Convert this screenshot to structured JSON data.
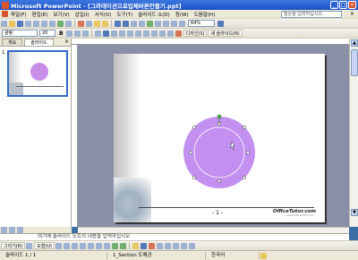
{
  "window": {
    "title": "Microsoft PowerPoint - [그라데이션으로입체바른만들기.ppt]",
    "controls": [
      "_",
      "□",
      "×"
    ]
  },
  "menubar": {
    "items": [
      "파일(F)",
      "편집(E)",
      "보기(V)",
      "삽입(I)",
      "서식(O)",
      "도구(T)",
      "슬라이드 쇼(D)",
      "창(W)",
      "도움말(H)"
    ],
    "help_placeholder": "질문을 입력하십시오.",
    "doc_close": "×"
  },
  "standard_toolbar": {
    "zoom": "64%",
    "design_label": "디자인(S)",
    "new_slide_label": "새 슬라이드(N)"
  },
  "format_toolbar": {
    "font": "굴림",
    "size": "20",
    "bold": "B"
  },
  "left_pane": {
    "tabs": [
      "개요",
      "슬라이드"
    ],
    "close": "×",
    "slide_number": "1"
  },
  "slide": {
    "page_label": "- 1 -",
    "logo": "OfficeTutor.com",
    "logo_sub": "www.officetutor.com",
    "circle_color": "#c38ff0"
  },
  "notes": {
    "placeholder": "여기에 슬라이드 노트의 내용을 입력하십시오"
  },
  "drawing_toolbar": {
    "draw_label": "그리기(R)",
    "autoshape_label": "도형(U)"
  },
  "statusbar": {
    "slide_pos": "슬라이드 1 / 1",
    "design": "1_Section 도해관",
    "language": "한국어"
  }
}
